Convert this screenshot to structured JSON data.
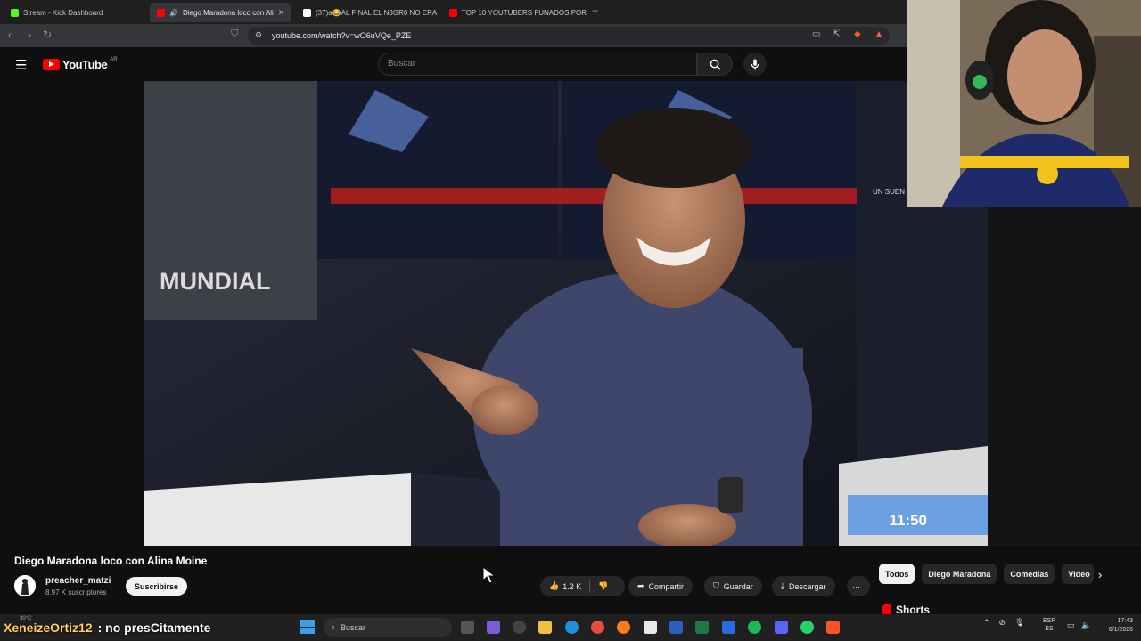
{
  "browser": {
    "tabs": [
      {
        "title": "Stream - Kick Dashboard",
        "active": false,
        "favicon_color": "#53fc18"
      },
      {
        "title": "Diego Maradona loco con Ali",
        "active": true,
        "favicon_color": "#ff0000"
      },
      {
        "title": "(37)a😂AL FINAL EL N3GR0 NO ERA",
        "active": false,
        "favicon_color": "#ffffff"
      },
      {
        "title": "TOP 10 YOUTUBERS FUNADOS POR...",
        "active": false,
        "favicon_color": "#ff0000"
      }
    ],
    "new_tab": "+",
    "url": "youtube.com/watch?v=wO6uVQe_PZE"
  },
  "youtube": {
    "logo_text": "YouTube",
    "country_code": "AR",
    "search_placeholder": "Buscar",
    "video": {
      "duration": "11:50",
      "overlay_text": "MUNDIAL",
      "overlay_text_2": "UN SUEN"
    },
    "title": "Diego Maradona loco con Alina Moine",
    "channel": {
      "name": "preacher_matzi",
      "subscribers": "8.97 K suscriptores",
      "subscribe_label": "Suscribirse"
    },
    "actions": {
      "likes": "1.2 K",
      "share": "Compartir",
      "save": "Guardar",
      "download": "Descargar",
      "more": "···"
    },
    "chips": [
      "Todos",
      "Diego Maradona",
      "Comedias",
      "Video"
    ],
    "shorts_label": "Shorts"
  },
  "overlay_chat": {
    "user": "XeneizeOrtiz12",
    "message": ": no presCitamente"
  },
  "taskbar": {
    "weather": "30°C",
    "search_placeholder": "Buscar",
    "language_top": "ESP",
    "language_bottom": "ES",
    "time": "17:43",
    "date": "6/1/2026"
  }
}
